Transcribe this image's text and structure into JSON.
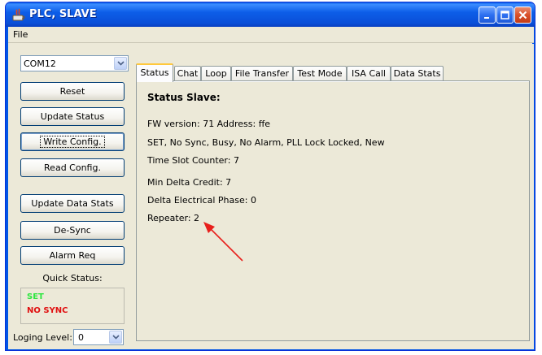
{
  "window": {
    "title": "PLC, SLAVE"
  },
  "menu": {
    "file": "File"
  },
  "left": {
    "port": "COM12",
    "buttons": {
      "reset": "Reset",
      "update_status": "Update Status",
      "write_config": "Write Config.",
      "read_config": "Read Config.",
      "update_data_stats": "Update Data Stats",
      "de_sync": "De-Sync",
      "alarm_req": "Alarm Req"
    },
    "quick_status_label": "Quick Status:",
    "quick_status": {
      "set": "SET",
      "sync": "NO SYNC"
    },
    "quick_status_colors": {
      "set": "#2ee640",
      "sync": "#e01010"
    },
    "logging_label": "Loging Level:",
    "logging_value": "0"
  },
  "tabs": [
    "Status",
    "Chat",
    "Loop",
    "File Transfer",
    "Test Mode",
    "ISA Call",
    "Data Stats"
  ],
  "active_tab": "Status",
  "status": {
    "title": "Status Slave:",
    "fw_line": "FW version:  71  Address:  ffe",
    "flags_line": "SET,  No Sync,  Busy,  No Alarm,  PLL Lock  Locked,  New",
    "time_slot": "Time Slot Counter:  7",
    "min_delta": "Min Delta Credit:  7",
    "delta_phase": "Delta Electrical Phase:  0",
    "repeater": "Repeater:  2"
  },
  "annotation_color": "#e8201c"
}
